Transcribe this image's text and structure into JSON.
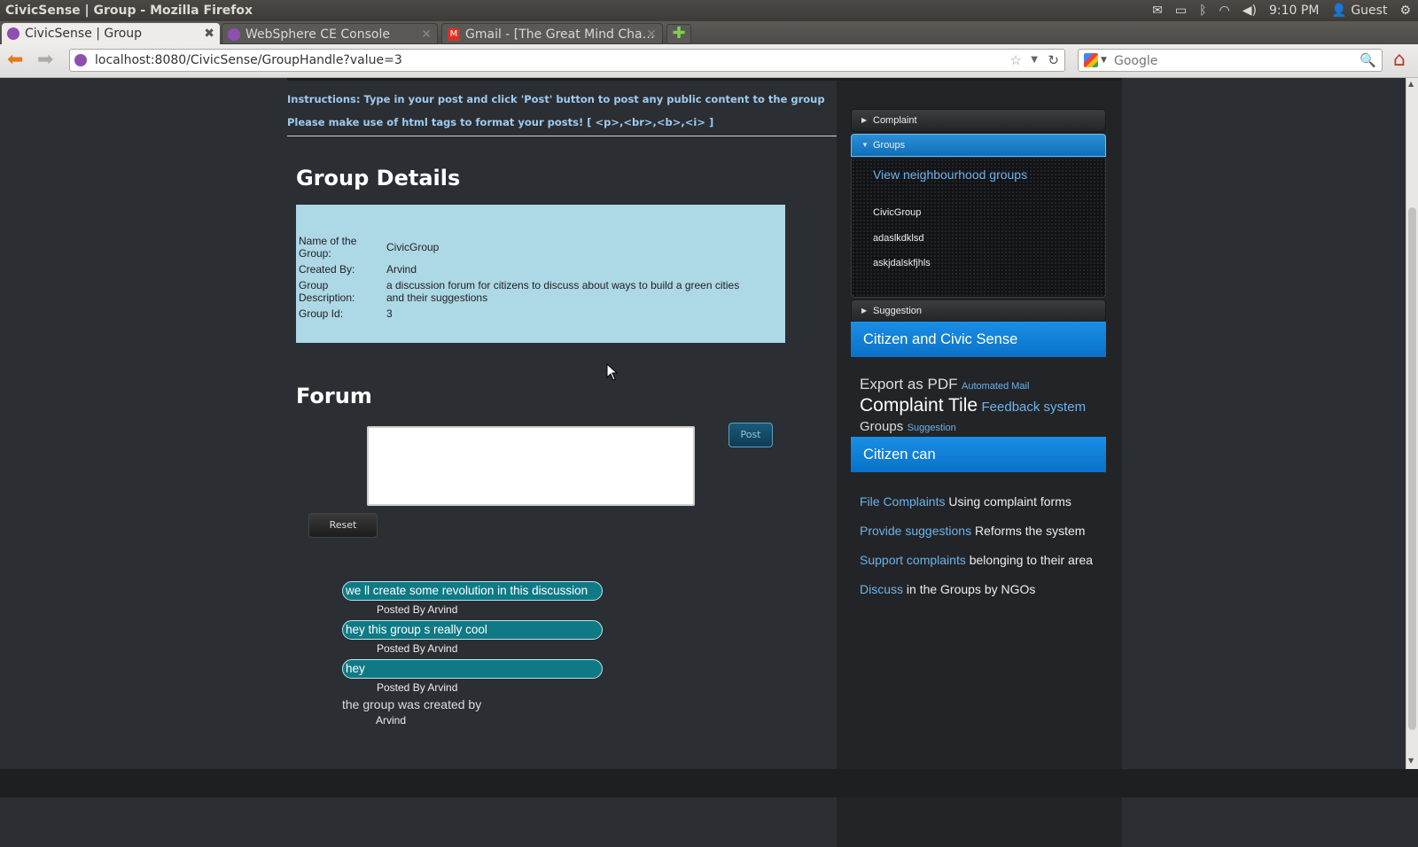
{
  "os_bar": {
    "window_title": "CivicSense | Group - Mozilla Firefox",
    "time": "9:10 PM",
    "user": "Guest"
  },
  "tabs": [
    {
      "label": "CivicSense | Group",
      "active": true,
      "close": "✖"
    },
    {
      "label": "WebSphere CE Console",
      "active": false,
      "close": "✕"
    },
    {
      "label": "Gmail - [The Great Mind Cha…",
      "active": false,
      "close": "✕"
    }
  ],
  "new_tab": "✚",
  "nav": {
    "url": "localhost:8080/CivicSense/GroupHandle?value=3",
    "search_placeholder": "Google"
  },
  "page": {
    "instruction_1": "Instructions: Type in your post and click 'Post' button to post any public content to the group",
    "instruction_2": "Please make use of html tags to format your posts! [  <p>,<br>,<b>,<i>  ]",
    "group_details_heading": "Group Details",
    "details": {
      "name_label": "Name of the Group:",
      "name_value": "CivicGroup",
      "created_label": "Created By:",
      "created_value": "Arvind",
      "desc_label": "Group Description:",
      "desc_value": "a discussion forum for citizens to discuss about ways to build a green cities and their suggestions",
      "id_label": "Group Id:",
      "id_value": "3"
    },
    "forum_heading": "Forum",
    "post_label": "Post",
    "reset_label": "Reset",
    "posts": [
      {
        "text": "we ll create some revolution in this discussion",
        "by": "Posted By Arvind"
      },
      {
        "text": "hey this group s really cool",
        "by": "Posted By Arvind"
      },
      {
        "text": "hey",
        "by": "Posted By Arvind"
      }
    ],
    "created_by_text": "the group was created by",
    "created_by_name": "Arvind"
  },
  "sidebar": {
    "complaint": "Complaint",
    "groups": "Groups",
    "view_groups": "View neighbourhood groups",
    "group_list": [
      "CivicGroup",
      "adaslkdklsd",
      "askjdalskfjhls"
    ],
    "suggestion": "Suggestion",
    "banner_1": "Citizen and Civic Sense",
    "tags": {
      "export_pdf": "Export as PDF",
      "automated_mail": "Automated Mail",
      "complaint_tile": "Complaint Tile",
      "feedback_system": "Feedback system",
      "groups": "Groups",
      "suggestion": "Suggestion"
    },
    "banner_2": "Citizen can",
    "capabilities": [
      {
        "link": "File Complaints",
        "text": "Using complaint forms"
      },
      {
        "link": "Provide suggestions",
        "text": "Reforms the system"
      },
      {
        "link": "Support complaints",
        "text": "belonging to their area"
      },
      {
        "link": "Discuss",
        "text": "in the Groups by NGOs"
      }
    ]
  },
  "colors": {
    "page_bg": "#2b2e33",
    "details_bg": "#add8e6",
    "accent_blue": "#1a8ee6",
    "post_bubble": "#0f7a86",
    "link": "#6db3ea"
  }
}
